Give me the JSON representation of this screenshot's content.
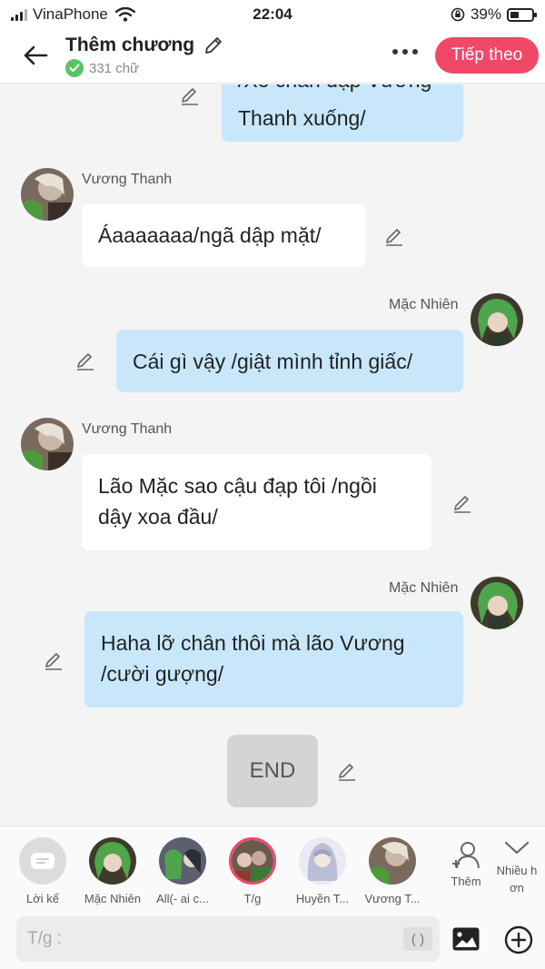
{
  "status_bar": {
    "carrier": "VinaPhone",
    "time": "22:04",
    "battery": "39%",
    "battery_level": 0.39
  },
  "header": {
    "title": "Thêm chương",
    "word_count": "331 chữ",
    "next_label": "Tiếp theo"
  },
  "messages": [
    {
      "speaker": "",
      "side": "right",
      "text": "Thanh xuống/",
      "partial_top": "/Xô chân đạp Vương"
    },
    {
      "speaker": "Vương Thanh",
      "side": "left",
      "text": "Áaaaaaaa/ngã dập mặt/"
    },
    {
      "speaker": "Mặc Nhiên",
      "side": "right",
      "text": "Cái gì vậy /giật mình tỉnh giấc/"
    },
    {
      "speaker": "Vương Thanh",
      "side": "left",
      "text": "Lão Mặc sao cậu đạp tôi /ngồi dậy xoa đầu/"
    },
    {
      "speaker": "Mặc Nhiên",
      "side": "right",
      "text": "Haha lỡ chân thôi mà lão Vương /cười gượng/"
    }
  ],
  "end_label": "END",
  "characters": [
    {
      "label": "Lời kể"
    },
    {
      "label": "Mặc Nhiên"
    },
    {
      "label": "All(- ai c..."
    },
    {
      "label": "T/g"
    },
    {
      "label": "Huyền T..."
    },
    {
      "label": "Vương T..."
    }
  ],
  "actions": {
    "add_label": "Thêm",
    "more_label_1": "Nhiều h",
    "more_label_2": "ơn"
  },
  "input": {
    "placeholder": "T/g  :",
    "paren": "( )"
  },
  "colors": {
    "accent": "#f1486a",
    "bubble_blue": "#c8e7fb",
    "check_green": "#5ac463"
  }
}
